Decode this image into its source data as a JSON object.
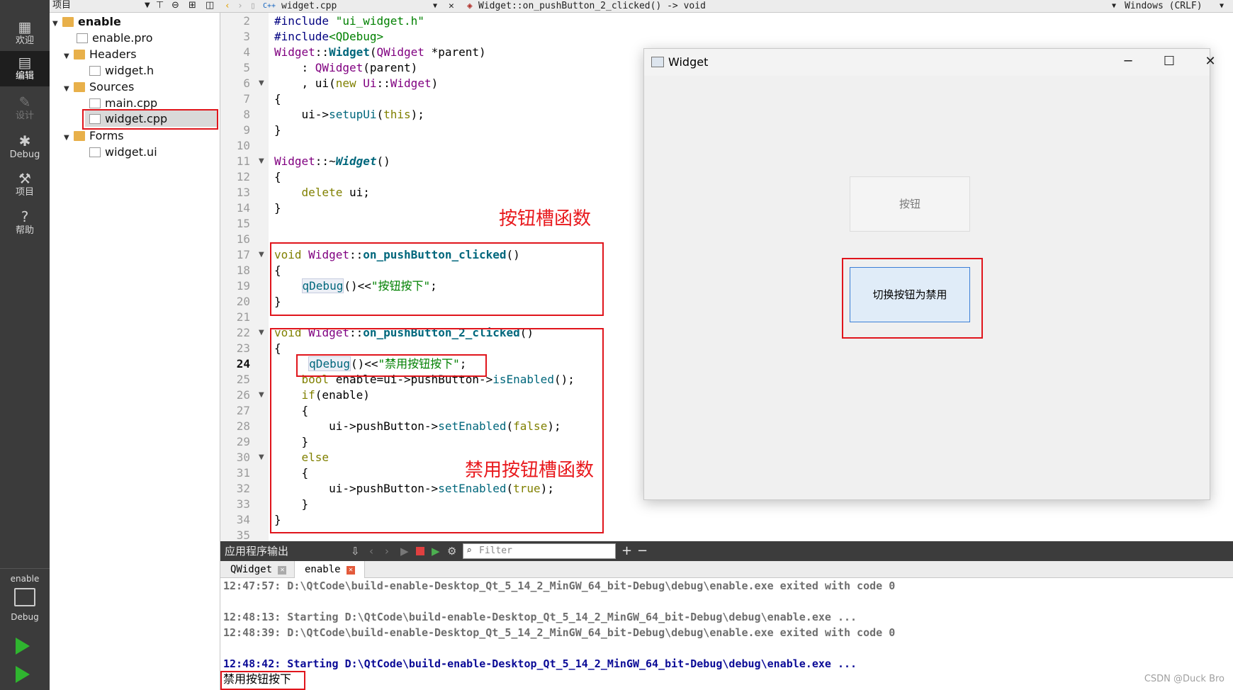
{
  "modes": [
    {
      "label": "欢迎",
      "icon": "grid-icon"
    },
    {
      "label": "编辑",
      "icon": "edit-icon"
    },
    {
      "label": "设计",
      "icon": "pencil-icon"
    },
    {
      "label": "Debug",
      "icon": "bug-icon"
    },
    {
      "label": "项目",
      "icon": "wrench-icon"
    },
    {
      "label": "帮助",
      "icon": "help-icon"
    }
  ],
  "kit": {
    "project": "enable",
    "config": "Debug"
  },
  "tree_header": "项目",
  "tree": [
    {
      "label": "enable",
      "bold": true
    },
    {
      "label": "enable.pro"
    },
    {
      "label": "Headers"
    },
    {
      "label": "widget.h"
    },
    {
      "label": "Sources"
    },
    {
      "label": "main.cpp"
    },
    {
      "label": "widget.cpp",
      "selected": true
    },
    {
      "label": "Forms"
    },
    {
      "label": "widget.ui"
    }
  ],
  "editor": {
    "file_tab": "widget.cpp",
    "function_tab": "Widget::on_pushButton_2_clicked() -> void",
    "line_ending": "Windows (CRLF)",
    "line_numbers": [
      "2",
      "3",
      "4",
      "5",
      "6",
      "7",
      "8",
      "9",
      "10",
      "11",
      "12",
      "13",
      "14",
      "15",
      "16",
      "17",
      "18",
      "19",
      "20",
      "21",
      "22",
      "23",
      "24",
      "25",
      "26",
      "27",
      "28",
      "29",
      "30",
      "31",
      "32",
      "33",
      "34",
      "35"
    ],
    "current_line": "24"
  },
  "annotations": {
    "slot1": "按钮槽函数",
    "slot2": "禁用按钮槽函数"
  },
  "window": {
    "title": "Widget",
    "button1": "按钮",
    "button2": "切换按钮为禁用"
  },
  "output": {
    "pane_title": "应用程序输出",
    "filter_placeholder": "Filter",
    "tabs": [
      "QWidget",
      "enable"
    ],
    "lines": [
      "12:47:57: D:\\QtCode\\build-enable-Desktop_Qt_5_14_2_MinGW_64_bit-Debug\\debug\\enable.exe exited with code 0",
      "",
      "12:48:13: Starting D:\\QtCode\\build-enable-Desktop_Qt_5_14_2_MinGW_64_bit-Debug\\debug\\enable.exe ...",
      "12:48:39: D:\\QtCode\\build-enable-Desktop_Qt_5_14_2_MinGW_64_bit-Debug\\debug\\enable.exe exited with code 0",
      "",
      "12:48:42: Starting D:\\QtCode\\build-enable-Desktop_Qt_5_14_2_MinGW_64_bit-Debug\\debug\\enable.exe ...",
      "禁用按钮按下"
    ]
  },
  "watermark": "CSDN @Duck Bro"
}
